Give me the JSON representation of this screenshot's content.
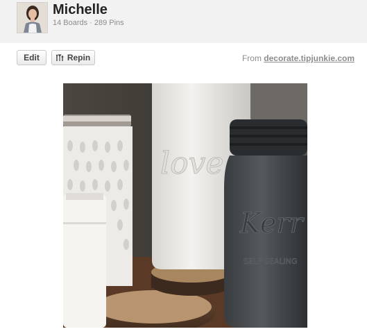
{
  "profile": {
    "name": "Michelle",
    "boards": "14 Boards",
    "separator": "·",
    "pins": "289 Pins"
  },
  "actions": {
    "edit_label": "Edit",
    "repin_label": "Repin"
  },
  "source": {
    "prefix": "From",
    "domain": "decorate.tipjunkie.com"
  },
  "pin": {
    "script_text": "love.",
    "jar_text": "Kerr",
    "jar_small_text": "SELF SEALING"
  },
  "icons": {
    "avatar": "user-photo",
    "repin": "repin-icon"
  }
}
